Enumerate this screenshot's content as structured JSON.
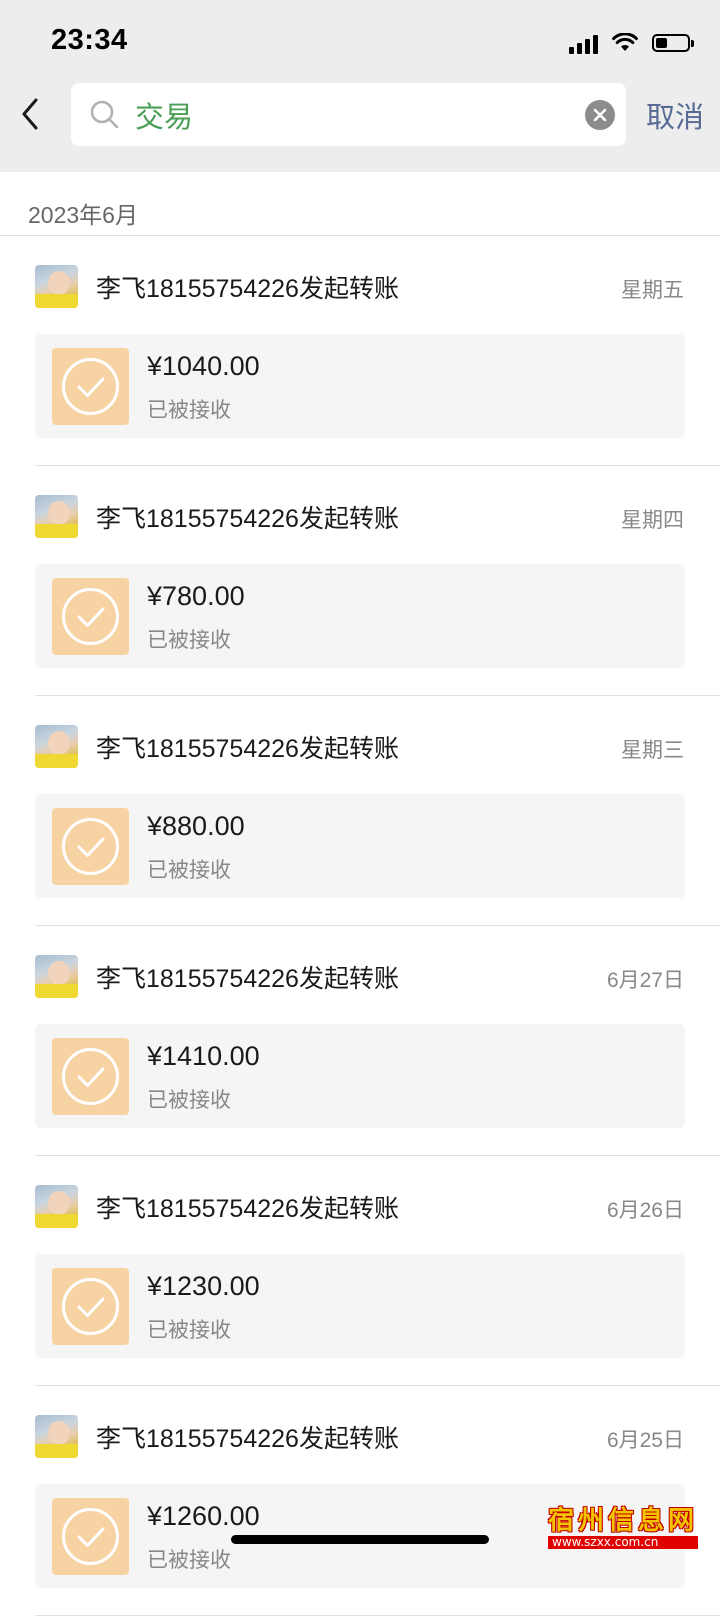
{
  "status_bar": {
    "time": "23:34",
    "battery_level": 0.35
  },
  "search": {
    "query": "交易",
    "cancel_label": "取消"
  },
  "month_label": "2023年6月",
  "transactions": [
    {
      "title": "李飞18155754226发起转账",
      "date": "星期五",
      "amount": "¥1040.00",
      "status": "已被接收"
    },
    {
      "title": "李飞18155754226发起转账",
      "date": "星期四",
      "amount": "¥780.00",
      "status": "已被接收"
    },
    {
      "title": "李飞18155754226发起转账",
      "date": "星期三",
      "amount": "¥880.00",
      "status": "已被接收"
    },
    {
      "title": "李飞18155754226发起转账",
      "date": "6月27日",
      "amount": "¥1410.00",
      "status": "已被接收"
    },
    {
      "title": "李飞18155754226发起转账",
      "date": "6月26日",
      "amount": "¥1230.00",
      "status": "已被接收"
    },
    {
      "title": "李飞18155754226发起转账",
      "date": "6月25日",
      "amount": "¥1260.00",
      "status": "已被接收"
    }
  ],
  "watermark": {
    "text": "宿州信息网",
    "url": "www.szxx.com.cn"
  },
  "colors": {
    "search_text": "#4a9e56",
    "cancel_link": "#576b95",
    "transfer_icon_bg": "#f7d3a4",
    "card_bg": "#f5f5f5",
    "header_bg": "#ededed"
  }
}
